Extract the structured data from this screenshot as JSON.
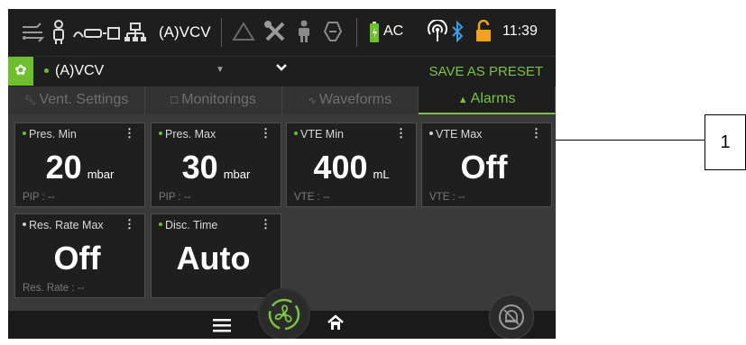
{
  "status_bar": {
    "mode": "(A)VCV",
    "power": "AC",
    "time": "11:39",
    "icons": [
      "ventilation-circuit-icon",
      "patient-icon",
      "device-connect-icon",
      "network-icon",
      "warning-triangle-icon",
      "tools-icon",
      "patient-adult-icon",
      "mask-icon",
      "battery-icon",
      "wireless-icon",
      "bluetooth-icon",
      "unlock-icon"
    ]
  },
  "mode_bar": {
    "selected_mode": "(A)VCV",
    "save_preset_label": "SAVE AS PRESET"
  },
  "tabs": [
    {
      "label": "Vent. Settings",
      "icon": "wrench-icon",
      "active": false
    },
    {
      "label": "Monitorings",
      "icon": "monitor-icon",
      "active": false
    },
    {
      "label": "Waveforms",
      "icon": "wave-icon",
      "active": false
    },
    {
      "label": "Alarms",
      "icon": "bell-icon",
      "active": true
    }
  ],
  "alarms": [
    {
      "name": "Pres. Min",
      "value": "20",
      "unit": "mbar",
      "monitor": "PIP : --",
      "dot_color": "#6ebe2e"
    },
    {
      "name": "Pres. Max",
      "value": "30",
      "unit": "mbar",
      "monitor": "PIP : --",
      "dot_color": "#6ebe2e"
    },
    {
      "name": "VTE Min",
      "value": "400",
      "unit": "mL",
      "monitor": "VTE : --",
      "dot_color": "#6ebe2e"
    },
    {
      "name": "VTE Max",
      "value": "Off",
      "unit": "",
      "monitor": "VTE : --",
      "dot_color": "#d0d0d0"
    },
    {
      "name": "Res. Rate Max",
      "value": "Off",
      "unit": "",
      "monitor": "Res. Rate : --",
      "dot_color": "#d0d0d0"
    },
    {
      "name": "Disc. Time",
      "value": "Auto",
      "unit": "",
      "monitor": "",
      "dot_color": "#6ebe2e"
    }
  ],
  "callout": {
    "label": "1"
  },
  "colors": {
    "accent": "#7cc242",
    "panel": "#1f1f1f",
    "background": "#3a3a3a"
  }
}
